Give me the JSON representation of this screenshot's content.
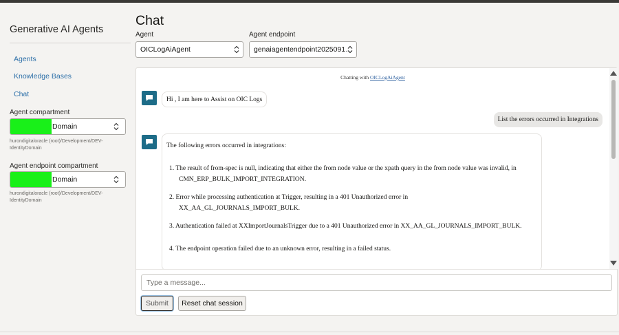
{
  "sidebar": {
    "app_title": "Generative AI Agents",
    "nav": [
      "Agents",
      "Knowledge Bases",
      "Chat"
    ],
    "agent_compartment": {
      "label": "Agent compartment",
      "value": "Domain",
      "path": "hurondigitaloracle (root)/Development/DEV-IdentityDomain"
    },
    "endpoint_compartment": {
      "label": "Agent endpoint compartment",
      "value": "Domain",
      "path": "hurondigitaloracle (root)/Development/DEV-IdentityDomain"
    }
  },
  "main": {
    "title": "Chat",
    "agent_label": "Agent",
    "agent_value": "OICLogAiAgent",
    "endpoint_label": "Agent endpoint",
    "endpoint_value": "genaiagentendpoint2025091…"
  },
  "chat": {
    "chatting_with_prefix": "Chatting with ",
    "chatting_with_agent": "OICLogAiAgent",
    "greeting": "Hi , I am here to Assist on OIC Logs",
    "user_message": "List the errors occurred in Integrations",
    "response_intro": "The following errors occurred in integrations:",
    "response_items": [
      {
        "line": "1. The result of from-spec is null, indicating that either the from node value or the xpath query in the from node value was invalid, in",
        "cont": "CMN_ERP_BULK_IMPORT_INTEGRATION."
      },
      {
        "line": "2. Error while processing authentication at Trigger, resulting in a 401 Unauthorized error in",
        "cont": "XX_AA_GL_JOURNALS_IMPORT_BULK."
      },
      {
        "line": "3. Authentication failed at XXImportJournalsTrigger due to a 401 Unauthorized error in XX_AA_GL_JOURNALS_IMPORT_BULK.",
        "cont": ""
      },
      {
        "line": "4. The endpoint operation failed due to an unknown error, resulting in a failed status.",
        "cont": ""
      }
    ]
  },
  "composer": {
    "placeholder": "Type a message...",
    "submit_label": "Submit",
    "reset_label": "Reset chat session"
  },
  "icons": {
    "chevron": "chevron-up-down-icon",
    "avatar": "chat-bubble-icon"
  },
  "colors": {
    "link": "#2c6fa8",
    "avatar": "#1d6c88",
    "redaction": "#19f019",
    "user_bubble": "#e8e7e5"
  }
}
